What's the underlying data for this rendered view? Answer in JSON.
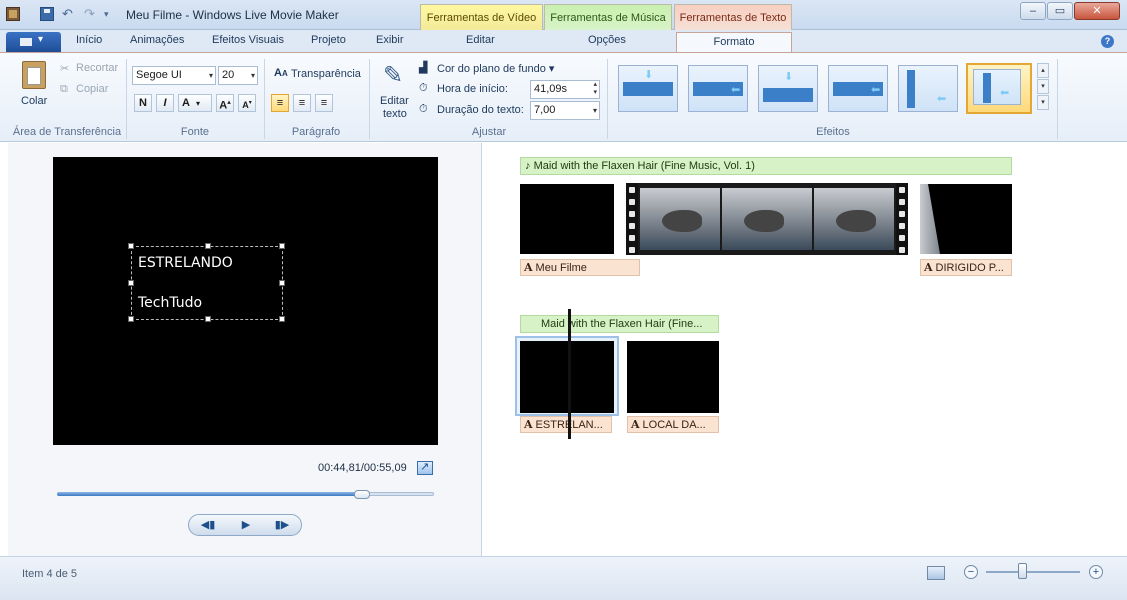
{
  "window": {
    "title": "Meu Filme - Windows Live Movie Maker",
    "context_tabs": {
      "video": "Ferramentas de Vídeo",
      "music": "Ferramentas de Música",
      "text": "Ferramentas de Texto"
    }
  },
  "tabs": {
    "inicio": "Início",
    "animacoes": "Animações",
    "efeitos": "Efeitos Visuais",
    "projeto": "Projeto",
    "exibir": "Exibir",
    "editar": "Editar",
    "opcoes": "Opções",
    "formato": "Formato"
  },
  "ribbon": {
    "clipboard": {
      "label": "Área de Transferência",
      "paste": "Colar",
      "cut": "Recortar",
      "copy": "Copiar"
    },
    "font": {
      "label": "Fonte",
      "family": "Segoe UI",
      "size": "20",
      "bold": "N",
      "italic": "I",
      "color": "A",
      "grow": "A",
      "shrink": "A",
      "transparency": "Transparência"
    },
    "paragraph": {
      "label": "Parágrafo"
    },
    "adjust": {
      "label": "Ajustar",
      "edit_text": "Editar",
      "edit_text_2": "texto",
      "bg_color": "Cor do plano de fundo",
      "start_time_label": "Hora de início:",
      "start_time_value": "41,09s",
      "duration_label": "Duração do texto:",
      "duration_value": "7,00"
    },
    "effects": {
      "label": "Efeitos"
    }
  },
  "preview": {
    "caption_line1": "ESTRELANDO",
    "caption_line2": "TechTudo",
    "time": "00:44,81/00:55,09",
    "progress": 0.81
  },
  "storyboard": {
    "row1": {
      "music": "Maid with the Flaxen Hair (Fine Music, Vol. 1)",
      "title_left": "Meu Filme",
      "title_right": "DIRIGIDO P..."
    },
    "row2": {
      "music": "Maid with the Flaxen Hair (Fine...",
      "title_left": "ESTRELAN...",
      "title_right": "LOCAL DA..."
    }
  },
  "status": {
    "text": "Item 4 de 5",
    "zoom": 0.38
  },
  "colors": {
    "accent": "#3c78c2",
    "music_bar": "#d6f2c6",
    "title_bar": "#fbe3d2",
    "selected_effect": "#ffd97a"
  }
}
